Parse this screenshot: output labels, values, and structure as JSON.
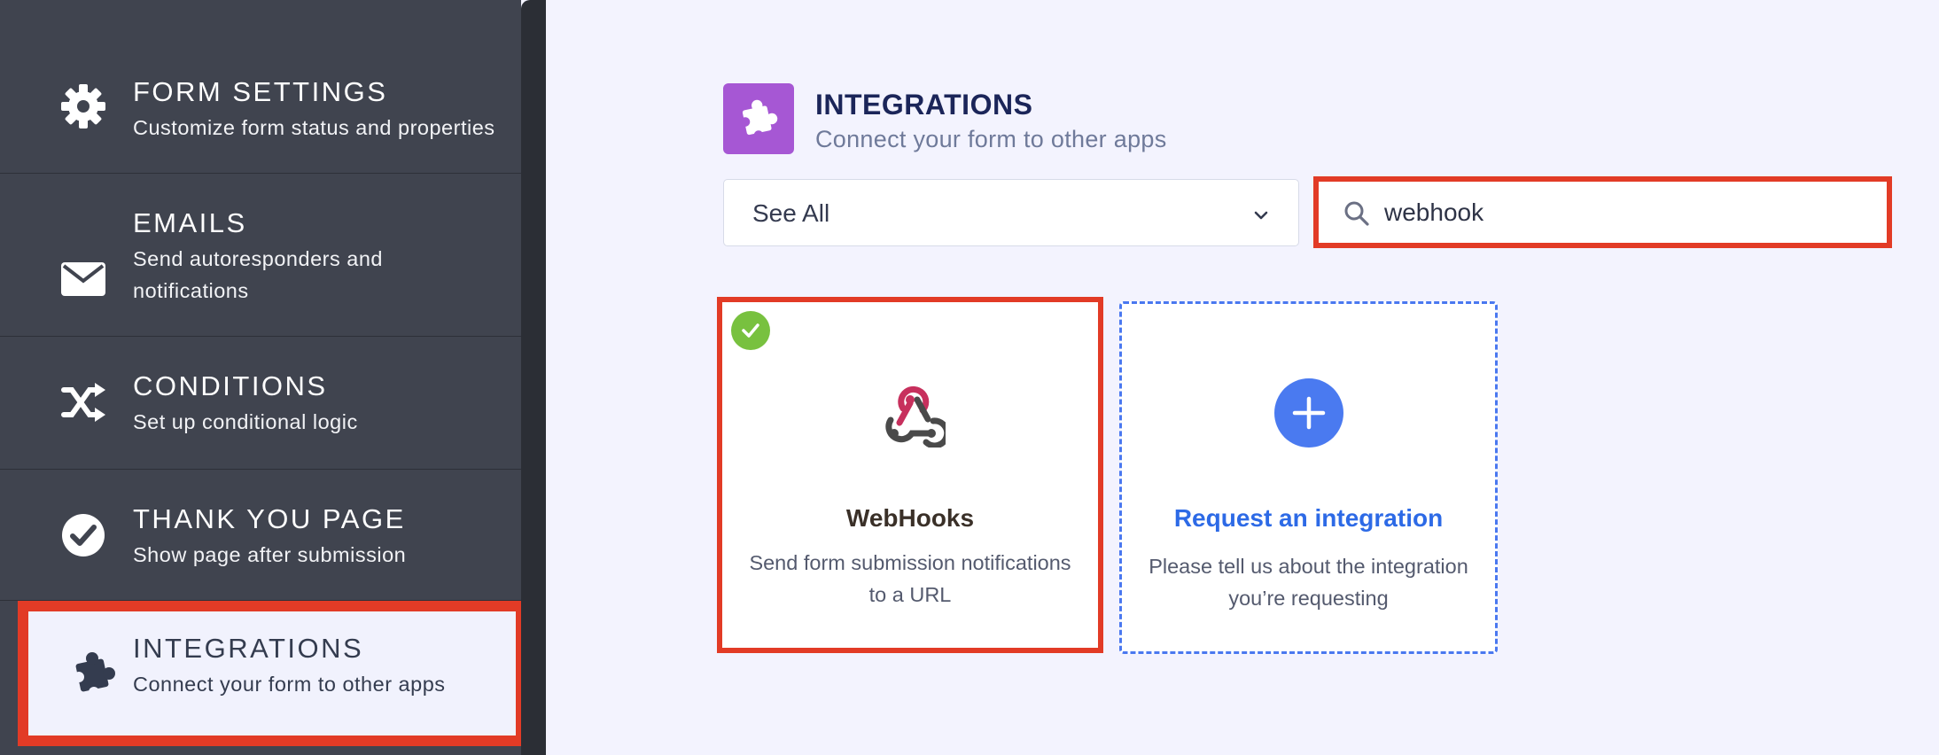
{
  "sidebar": {
    "items": [
      {
        "title": "FORM SETTINGS",
        "subtitle": "Customize form status and properties",
        "icon": "gear-icon"
      },
      {
        "title": "EMAILS",
        "subtitle": "Send autoresponders and notifications",
        "icon": "envelope-icon"
      },
      {
        "title": "CONDITIONS",
        "subtitle": "Set up conditional logic",
        "icon": "shuffle-icon"
      },
      {
        "title": "THANK YOU PAGE",
        "subtitle": "Show page after submission",
        "icon": "check-circle-icon"
      },
      {
        "title": "INTEGRATIONS",
        "subtitle": "Connect your form to other apps",
        "icon": "puzzle-icon",
        "active": true
      }
    ]
  },
  "header": {
    "title": "INTEGRATIONS",
    "subtitle": "Connect your form to other apps",
    "icon": "puzzle-icon",
    "icon_color": "#a657d4"
  },
  "filter": {
    "selected": "See All"
  },
  "search": {
    "value": "webhook"
  },
  "cards": [
    {
      "title": "WebHooks",
      "description": "Send form submission notifications to a URL",
      "icon": "webhook-icon",
      "connected": true
    },
    {
      "title": "Request an integration",
      "description": "Please tell us about the integration you’re requesting",
      "icon": "plus-icon"
    }
  ],
  "colors": {
    "sidebar_bg": "#40444f",
    "highlight": "#e23b26",
    "accent_blue": "#4a7af0",
    "success_green": "#78c13f"
  }
}
